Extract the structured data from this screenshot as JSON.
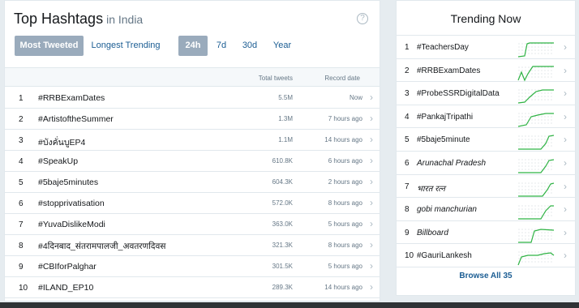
{
  "header": {
    "title": "Top Hashtags",
    "subtitle": "in India",
    "help_icon": "?"
  },
  "filters": {
    "mode": [
      "Most Tweeted",
      "Longest Trending"
    ],
    "periods": [
      "24h",
      "7d",
      "30d",
      "Year"
    ]
  },
  "table": {
    "columns": [
      "Total tweets",
      "Record date"
    ],
    "rows": [
      {
        "rank": "1",
        "tag": "#RRBExamDates",
        "total": "5.5M",
        "record": "Now"
      },
      {
        "rank": "2",
        "tag": "#ArtistoftheSummer",
        "total": "1.3M",
        "record": "7 hours ago"
      },
      {
        "rank": "3",
        "tag": "#บังคั่นบูEP4",
        "total": "1.1M",
        "record": "14 hours ago"
      },
      {
        "rank": "4",
        "tag": "#SpeakUp",
        "total": "610.8K",
        "record": "6 hours ago"
      },
      {
        "rank": "5",
        "tag": "#5baje5minutes",
        "total": "604.3K",
        "record": "2 hours ago"
      },
      {
        "rank": "6",
        "tag": "#stopprivatisation",
        "total": "572.0K",
        "record": "8 hours ago"
      },
      {
        "rank": "7",
        "tag": "#YuvaDislikeModi",
        "total": "363.0K",
        "record": "5 hours ago"
      },
      {
        "rank": "8",
        "tag": "#4दिनबाद_संतरामपालजी_अवतरणदिवस",
        "total": "321.3K",
        "record": "8 hours ago"
      },
      {
        "rank": "9",
        "tag": "#CBIforPalghar",
        "total": "301.5K",
        "record": "5 hours ago"
      },
      {
        "rank": "10",
        "tag": "#ILAND_EP10",
        "total": "289.3K",
        "record": "14 hours ago"
      }
    ]
  },
  "trending": {
    "title": "Trending Now",
    "items": [
      {
        "rank": "1",
        "tag": "#TeachersDay",
        "italic": false
      },
      {
        "rank": "2",
        "tag": "#RRBExamDates",
        "italic": false
      },
      {
        "rank": "3",
        "tag": "#ProbeSSRDigitalData",
        "italic": false
      },
      {
        "rank": "4",
        "tag": "#PankajTripathi",
        "italic": false
      },
      {
        "rank": "5",
        "tag": "#5baje5minute",
        "italic": false
      },
      {
        "rank": "6",
        "tag": "Arunachal Pradesh",
        "italic": true
      },
      {
        "rank": "7",
        "tag": "भारत रत्न",
        "italic": true
      },
      {
        "rank": "8",
        "tag": "gobi manchurian",
        "italic": true
      },
      {
        "rank": "9",
        "tag": "Billboard",
        "italic": true
      },
      {
        "rank": "10",
        "tag": "#GauriLankesh",
        "italic": false
      }
    ],
    "browse_label": "Browse All 35"
  },
  "colors": {
    "accent": "#1b5d93",
    "active_button": "#9aabbc",
    "sparkline": "#2fb344"
  }
}
